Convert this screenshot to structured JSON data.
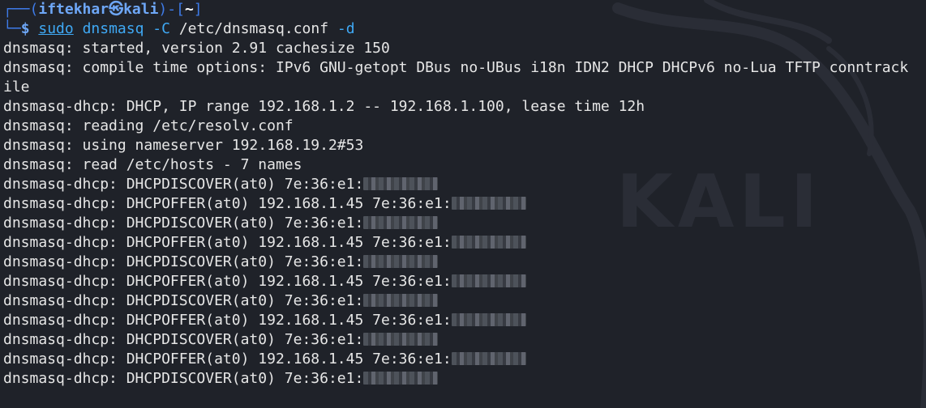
{
  "prompt": {
    "corner_top": "┌──(",
    "user": "iftekhar",
    "skull": "㉿",
    "host": "kali",
    "close_open": ")-[",
    "cwd": "~",
    "close": "]",
    "corner_bottom": "└─",
    "dollar": "$"
  },
  "command": {
    "sudo": "sudo",
    "program": "dnsmasq",
    "flag_c": "-C",
    "config_path": "/etc/dnsmasq.conf",
    "flag_d": "-d"
  },
  "output": [
    "dnsmasq: started, version 2.91 cachesize 150",
    "dnsmasq: compile time options: IPv6 GNU-getopt DBus no-UBus i18n IDN2 DHCP DHCPv6 no-Lua TFTP conntrack",
    "ile",
    "dnsmasq-dhcp: DHCP, IP range 192.168.1.2 -- 192.168.1.100, lease time 12h",
    "dnsmasq: reading /etc/resolv.conf",
    "dnsmasq: using nameserver 192.168.19.2#53",
    "dnsmasq: read /etc/hosts - 7 names"
  ],
  "dhcp_events": [
    {
      "text": "dnsmasq-dhcp: DHCPDISCOVER(at0) 7e:36:e1:"
    },
    {
      "text": "dnsmasq-dhcp: DHCPOFFER(at0) 192.168.1.45 7e:36:e1:"
    },
    {
      "text": "dnsmasq-dhcp: DHCPDISCOVER(at0) 7e:36:e1:"
    },
    {
      "text": "dnsmasq-dhcp: DHCPOFFER(at0) 192.168.1.45 7e:36:e1:"
    },
    {
      "text": "dnsmasq-dhcp: DHCPDISCOVER(at0) 7e:36:e1:"
    },
    {
      "text": "dnsmasq-dhcp: DHCPOFFER(at0) 192.168.1.45 7e:36:e1:"
    },
    {
      "text": "dnsmasq-dhcp: DHCPDISCOVER(at0) 7e:36:e1:"
    },
    {
      "text": "dnsmasq-dhcp: DHCPOFFER(at0) 192.168.1.45 7e:36:e1:"
    },
    {
      "text": "dnsmasq-dhcp: DHCPDISCOVER(at0) 7e:36:e1:"
    },
    {
      "text": "dnsmasq-dhcp: DHCPOFFER(at0) 192.168.1.45 7e:36:e1:"
    },
    {
      "text": "dnsmasq-dhcp: DHCPDISCOVER(at0) 7e:36:e1:"
    }
  ],
  "watermark": {
    "text": "KALI",
    "icon": "kali-dragon-icon"
  },
  "colors": {
    "background": "#1f2229",
    "prompt_blue": "#3e7be8",
    "command_cyan": "#3fa9f5",
    "text": "#e6e6e6"
  }
}
